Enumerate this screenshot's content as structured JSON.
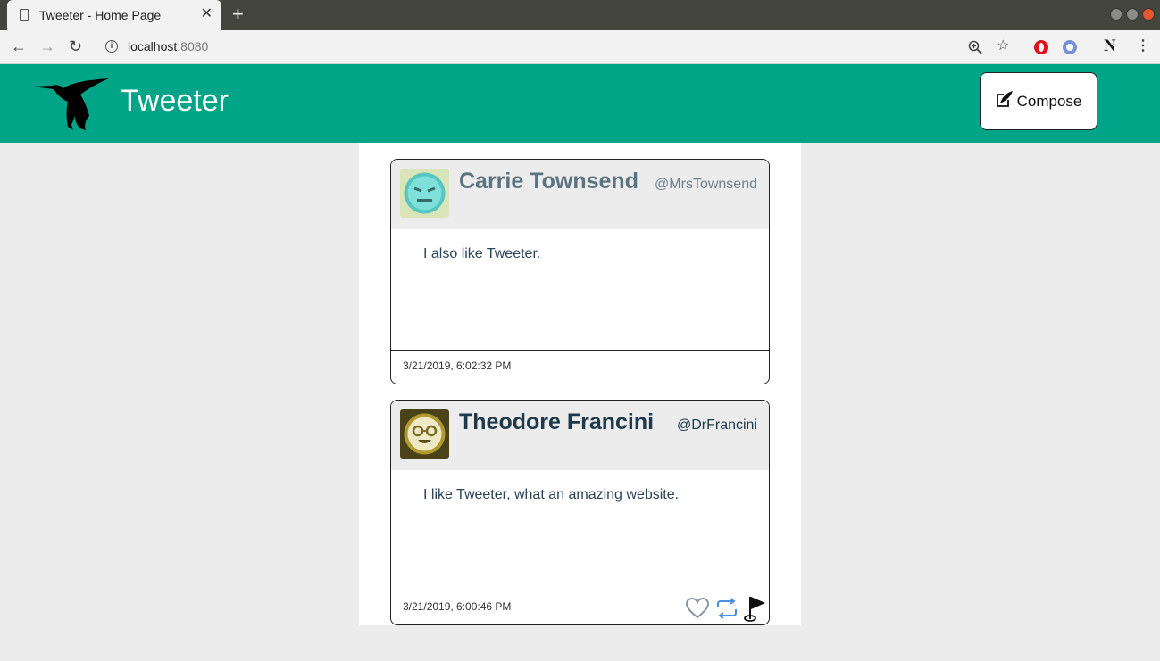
{
  "browser": {
    "tab_title": "Tweeter - Home Page",
    "tab_close": "✕",
    "new_tab": "+",
    "url_host": "localhost",
    "url_port": ":8080"
  },
  "header": {
    "brand": "Tweeter",
    "compose_label": "Compose"
  },
  "tweets": [
    {
      "name": "Carrie Townsend",
      "handle": "@MrsTownsend",
      "text": "I also like Tweeter.",
      "timestamp": "3/21/2019, 6:02:32 PM"
    },
    {
      "name": "Theodore Francini",
      "handle": "@DrFrancini",
      "text": "I like Tweeter, what an amazing website.",
      "timestamp": "3/21/2019, 6:00:46 PM"
    }
  ],
  "colors": {
    "header_bg": "#00a587",
    "page_bg": "#ececec",
    "card_header_bg": "#ececec",
    "like_icon": "#8a97a3",
    "retweet_icon": "#4a90e2"
  }
}
